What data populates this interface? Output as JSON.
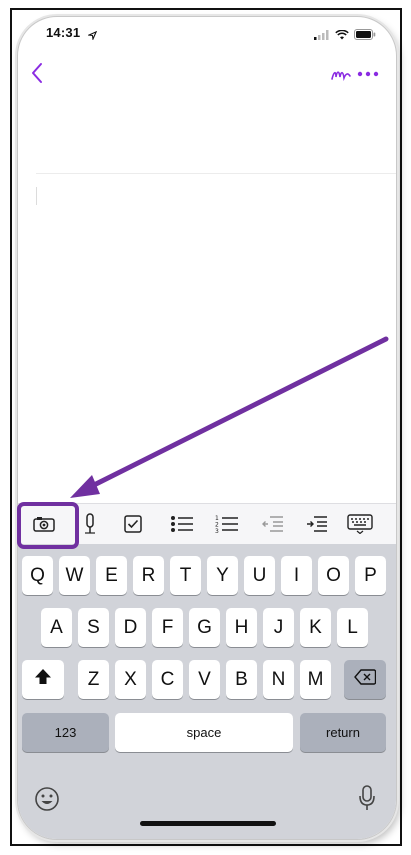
{
  "status_bar": {
    "time": "14:31"
  },
  "keyboard": {
    "row1": [
      "Q",
      "W",
      "E",
      "R",
      "T",
      "Y",
      "U",
      "I",
      "O",
      "P"
    ],
    "row2": [
      "A",
      "S",
      "D",
      "F",
      "G",
      "H",
      "J",
      "K",
      "L"
    ],
    "row3": [
      "Z",
      "X",
      "C",
      "V",
      "B",
      "N",
      "M"
    ],
    "numbers_label": "123",
    "space_label": "space",
    "return_label": "return"
  },
  "colors": {
    "accent": "#8a2be2",
    "annotation": "#7030a0",
    "keyboard_bg": "#d1d3d9"
  },
  "icons": [
    "back-chevron-icon",
    "pen-icon",
    "more-icon",
    "camera-icon",
    "microphone-icon",
    "checkbox-icon",
    "bullet-list-icon",
    "numbered-list-icon",
    "outdent-icon",
    "indent-icon",
    "keyboard-hide-icon",
    "shift-icon",
    "backspace-icon",
    "emoji-icon",
    "dictation-icon"
  ]
}
